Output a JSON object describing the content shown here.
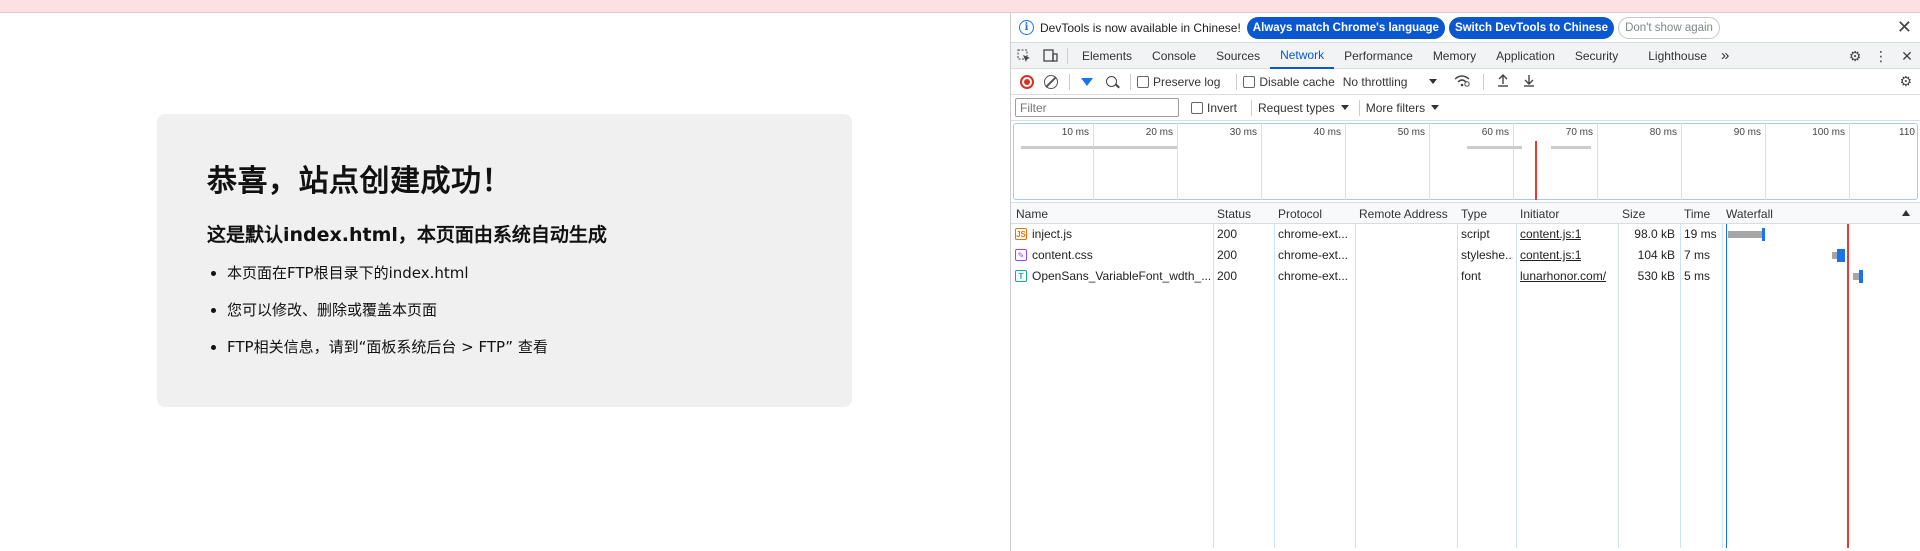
{
  "page": {
    "heading": "恭喜，站点创建成功！",
    "subheading": "这是默认index.html，本页面由系统自动生成",
    "bullets": [
      "本页面在FTP根目录下的index.html",
      "您可以修改、删除或覆盖本页面",
      "FTP相关信息，请到“面板系统后台 > FTP” 查看"
    ]
  },
  "devtools": {
    "infobar": {
      "message": "DevTools is now available in Chinese!",
      "btn_match": "Always match Chrome's language",
      "btn_switch": "Switch DevTools to Chinese",
      "btn_dismiss": "Don't show again"
    },
    "tabs": [
      "Elements",
      "Console",
      "Sources",
      "Network",
      "Performance",
      "Memory",
      "Application",
      "Security",
      "Lighthouse"
    ],
    "active_tab": "Network",
    "more_tabs": "»",
    "toolbar": {
      "preserve_log": "Preserve log",
      "disable_cache": "Disable cache",
      "throttling": "No throttling"
    },
    "filterbar": {
      "placeholder": "Filter",
      "invert": "Invert",
      "request_types": "Request types",
      "more_filters": "More filters"
    },
    "overview": {
      "ticks": [
        "10 ms",
        "20 ms",
        "30 ms",
        "40 ms",
        "50 ms",
        "60 ms",
        "70 ms",
        "80 ms",
        "90 ms",
        "100 ms",
        "110"
      ]
    },
    "columns": [
      "Name",
      "Status",
      "Protocol",
      "Remote Address",
      "Type",
      "Initiator",
      "Size",
      "Time",
      "Waterfall"
    ],
    "rows": [
      {
        "icon": "js",
        "name": "inject.js",
        "status": "200",
        "protocol": "chrome-ext...",
        "remote": "",
        "type": "script",
        "initiator": "content.js:1",
        "size": "98.0 kB",
        "time": "19 ms"
      },
      {
        "icon": "css",
        "name": "content.css",
        "status": "200",
        "protocol": "chrome-ext...",
        "remote": "",
        "type": "styleshe...",
        "initiator": "content.js:1",
        "size": "104 kB",
        "time": "7 ms"
      },
      {
        "icon": "font",
        "name": "OpenSans_VariableFont_wdth_...",
        "status": "200",
        "protocol": "chrome-ext...",
        "remote": "",
        "type": "font",
        "initiator": "lunarhonor.com/",
        "size": "530 kB",
        "time": "5 ms"
      }
    ],
    "colors": {
      "accent": "#0b57d0",
      "record": "#d93025",
      "load_line": "#e53935"
    }
  }
}
